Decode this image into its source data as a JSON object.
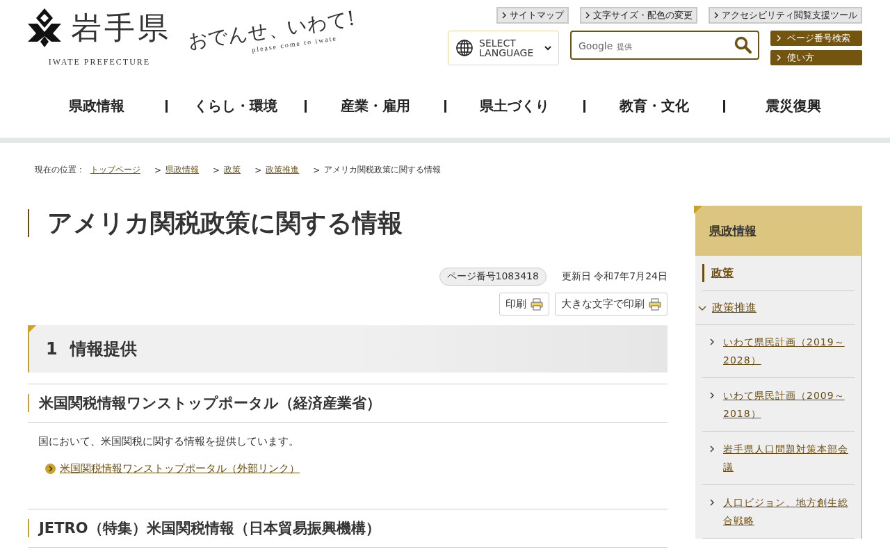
{
  "header": {
    "logo_text": "岩手県",
    "logo_subtext": "IWATE PREFECTURE",
    "tagline": "おでんせ、いわて!",
    "tagline_sub": "please come to iwate",
    "utility_links": [
      "サイトマップ",
      "文字サイズ・配色の変更",
      "アクセシビリティ閲覧支援ツール"
    ],
    "language_select": "SELECT LANGUAGE",
    "search": {
      "brand": "Google",
      "brand_suffix": "提供"
    },
    "quick_buttons": [
      "ページ番号検索",
      "使い方"
    ],
    "nav": [
      "県政情報",
      "くらし・環境",
      "産業・雇用",
      "県土づくり",
      "教育・文化",
      "震災復興"
    ]
  },
  "breadcrumb": {
    "label": "現在の位置：",
    "separator": ">",
    "items": [
      {
        "text": "トップページ",
        "link": true
      },
      {
        "text": "県政情報",
        "link": true
      },
      {
        "text": "政策",
        "link": true
      },
      {
        "text": "政策推進",
        "link": true
      },
      {
        "text": "アメリカ関税政策に関する情報",
        "link": false
      }
    ]
  },
  "page_title": "アメリカ関税政策に関する情報",
  "page_number": "ページ番号1083418",
  "updated": "更新日 令和7年7月24日",
  "print_buttons": [
    "印刷",
    "大きな文字で印刷"
  ],
  "content": [
    {
      "kind": "h2",
      "number": "1",
      "text": "情報提供"
    },
    {
      "kind": "h3",
      "text": "米国関税情報ワンストップポータル（経済産業省）"
    },
    {
      "kind": "p",
      "text": "国において、米国関税に関する情報を提供しています。"
    },
    {
      "kind": "link",
      "text": "米国関税情報ワンストップポータル（外部リンク）"
    },
    {
      "kind": "h3",
      "text": "JETRO（特集）米国関税情報（日本貿易振興機構）"
    }
  ],
  "sidebar": {
    "title": "県政情報",
    "section": "政策",
    "items": [
      {
        "label": "政策推進",
        "expanded": true,
        "children": [
          {
            "label": "いわて県民計画（2019～2028）"
          },
          {
            "label": "いわて県民計画（2009～2018）"
          },
          {
            "label": "岩手県人口問題対策本部会議"
          },
          {
            "label": "人口ビジョン、地方創生総合戦略"
          }
        ]
      }
    ]
  }
}
